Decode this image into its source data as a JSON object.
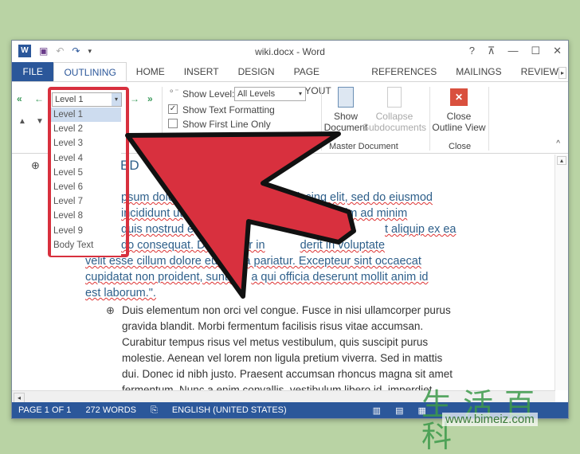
{
  "window": {
    "title": "wiki.docx - Word",
    "help": "?",
    "controls": [
      "ribbon-display",
      "minimize",
      "maximize",
      "close"
    ]
  },
  "qat": {
    "app_icon": "W",
    "icons": [
      "save-icon",
      "undo-icon",
      "redo-icon",
      "customize-icon"
    ]
  },
  "tabs": [
    "FILE",
    "OUTLINING",
    "HOME",
    "INSERT",
    "DESIGN",
    "PAGE LAYOUT",
    "REFERENCES",
    "MAILINGS",
    "REVIEW"
  ],
  "active_tab": "OUTLINING",
  "ribbon": {
    "level_combo": "Level 1",
    "show_level_label": "Show Level:",
    "show_level_value": "All Levels",
    "show_text_formatting": "Show Text Formatting",
    "show_text_formatting_checked": true,
    "show_first_line_only": "Show First Line Only",
    "show_document_l1": "Show",
    "show_document_l2": "Document",
    "collapse_l1": "Collapse",
    "collapse_l2": "Subdocuments",
    "master_group": "Master Document",
    "close_l1": "Close",
    "close_l2": "Outline View",
    "close_group": "Close"
  },
  "level_menu": [
    "Level 1",
    "Level 2",
    "Level 3",
    "Level 4",
    "Level 5",
    "Level 6",
    "Level 7",
    "Level 8",
    "Level 9",
    "Body Text"
  ],
  "level_menu_selected": "Level 1",
  "document": {
    "heading": "ED",
    "para1": [
      "psum dolo",
      "iscing elit, sed do eiusmod",
      "incididunt ut",
      "Ut enim ad minim",
      "quis nostrud e",
      "t aliquip ex ea",
      "do consequat. Dui",
      "e dolor in",
      "derit in voluptate",
      "velit esse cillum dolore eu fu",
      "la pariatur. Excepteur sint occaecat",
      "cupidatat non proident, sunt in",
      "a qui officia deserunt mollit anim id",
      "est laborum.\"."
    ],
    "para2": [
      "Duis elementum non orci vel congue. Fusce in nisi ullamcorper purus",
      "gravida blandit. Morbi fermentum facilisis risus vitae accumsan.",
      "Curabitur tempus risus vel metus vestibulum, quis suscipit purus",
      "molestie. Aenean vel lorem non ligula pretium viverra. Sed in mattis",
      "dui. Donec id nibh justo. Praesent accumsan rhoncus magna sit amet",
      "fermentum. Nunc a enim convallis, vestibulum libero id, imperdiet"
    ]
  },
  "status": {
    "page": "PAGE 1 OF 1",
    "words": "272 WORDS",
    "language": "ENGLISH (UNITED STATES)"
  },
  "watermark": {
    "chars": "生活百科",
    "url": "www.bimeiz.com"
  },
  "colors": {
    "accent": "#2b579a",
    "highlight_red": "#d8303e",
    "background": "#b9d3a4"
  }
}
